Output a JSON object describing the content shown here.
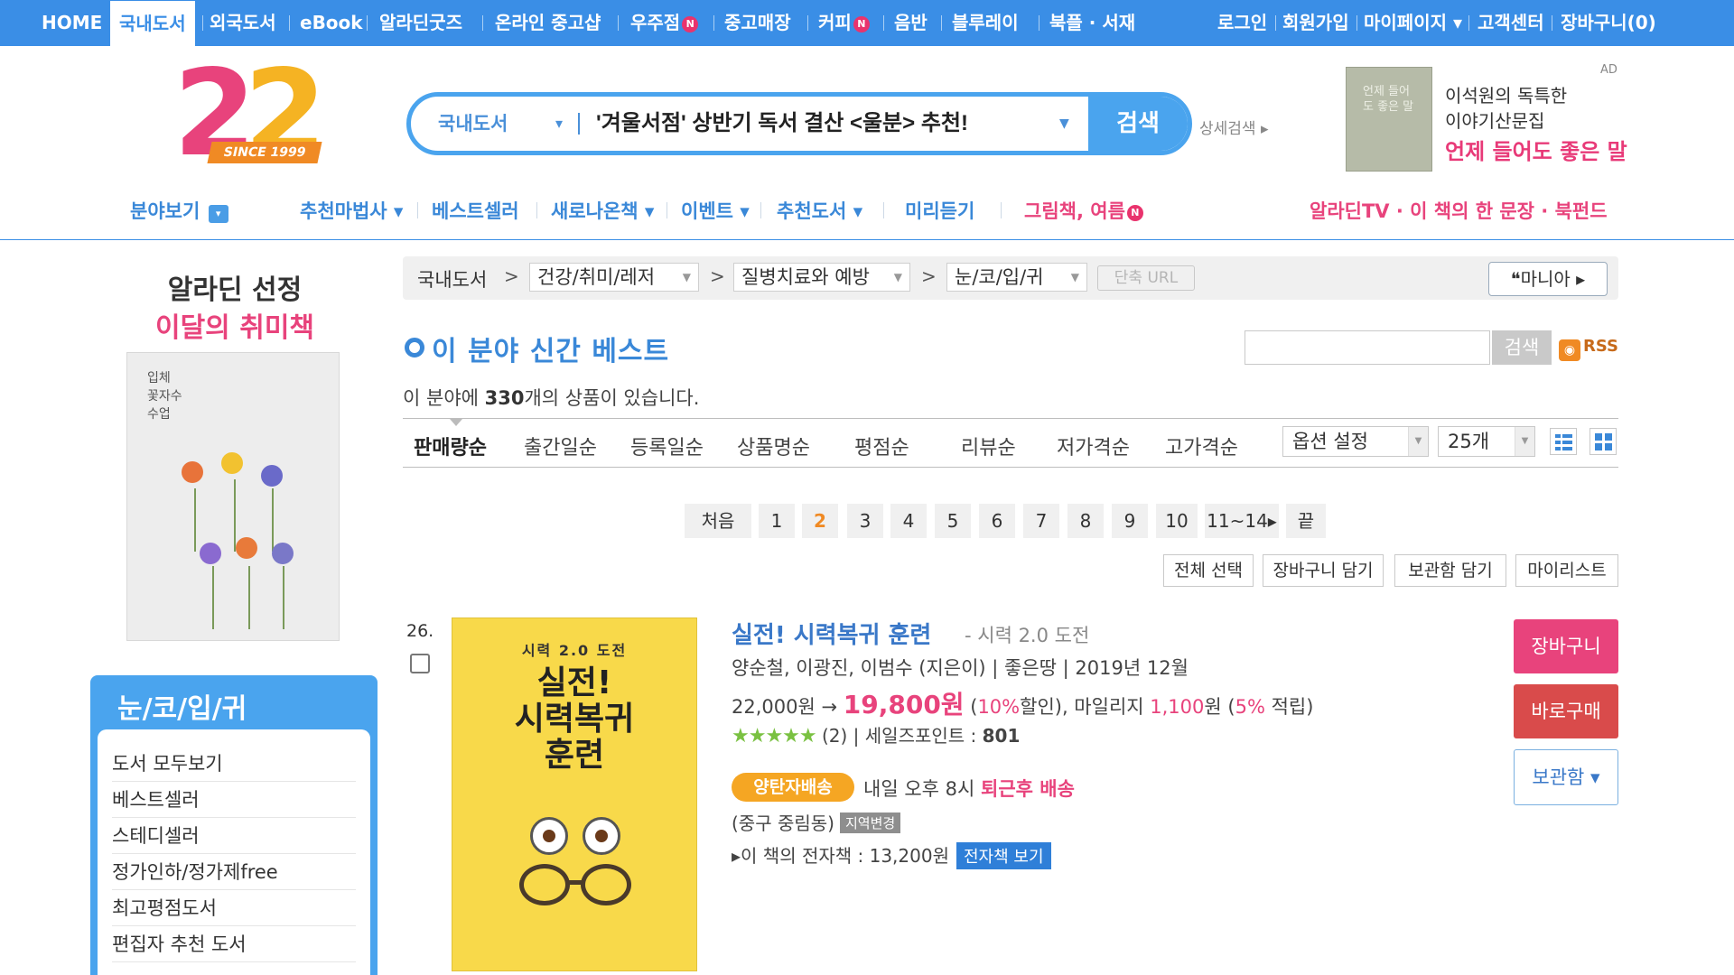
{
  "topnav": {
    "items": [
      "HOME",
      "국내도서",
      "외국도서",
      "eBook",
      "알라딘굿즈",
      "온라인 중고샵",
      "우주점",
      "중고매장",
      "커피",
      "음반",
      "블루레이",
      "북플 · 서재"
    ],
    "new_badge": "N",
    "right": [
      "로그인",
      "회원가입",
      "마이페이지 ▾",
      "고객센터",
      "장바구니(0)"
    ]
  },
  "logo": {
    "number": "22",
    "since": "SINCE 1999"
  },
  "search": {
    "category": "국내도서",
    "query": "'겨울서점' 상반기 독서 결산 <울분> 추천!",
    "button": "검색",
    "detail": "상세검색 ▸"
  },
  "ad": {
    "label": "AD",
    "book_title": "언제 들어도 좋은 말",
    "line1": "이석원의 독특한",
    "line2": "이야기산문집",
    "line3": "언제 들어도 좋은 말"
  },
  "catnav": {
    "field": "분야보기",
    "field_icon": "▾",
    "items": [
      "추천마법사 ▾",
      "베스트셀러",
      "새로나온책 ▾",
      "이벤트 ▾",
      "추천도서 ▾",
      "미리듣기"
    ],
    "pink_item": "그림책, 여름",
    "right_links": "알라딘TV · 이 책의 한 문장 · 북펀드"
  },
  "sidebar": {
    "title1": "알라딘 선정",
    "title2": "이달의 취미책",
    "book_title": "입체 꽃자수 수업",
    "box_title": "눈/코/입/귀",
    "links": [
      "도서 모두보기",
      "베스트셀러",
      "스테디셀러",
      "정가인하/정가제free",
      "최고평점도서",
      "편집자 추천 도서"
    ]
  },
  "breadcrumb": {
    "root": "국내도서",
    "sep": ">",
    "level1": "건강/취미/레저",
    "level2": "질병치료와 예방",
    "level3": "눈/코/입/귀",
    "short_url": "단축 URL",
    "mania": "❝마니아 ▸"
  },
  "section": {
    "title": "이 분야 신간 베스트",
    "search_button": "검색",
    "rss": "RSS",
    "count_prefix": "이 분야에 ",
    "count": "330",
    "count_suffix": "개의 상품이 있습니다."
  },
  "sort": {
    "options": [
      "판매량순",
      "출간일순",
      "등록일순",
      "상품명순",
      "평점순",
      "리뷰순",
      "저가격순",
      "고가격순"
    ],
    "option_select": "옵션 설정",
    "per_page": "25개"
  },
  "pagination": [
    "처음",
    "1",
    "2",
    "3",
    "4",
    "5",
    "6",
    "7",
    "8",
    "9",
    "10",
    "11~14▸",
    "끝"
  ],
  "current_page": "2",
  "actions": [
    "전체 선택",
    "장바구니 담기",
    "보관함 담기",
    "마이리스트"
  ],
  "item": {
    "rank": "26.",
    "cover_top": "시력 2.0 도전",
    "cover_title": "실전!\n시력복귀\n훈련",
    "title": "실전! 시력복귀 훈련",
    "subtitle": "- 시력 2.0 도전",
    "authors": "양순철, 이광진, 이범수 (지은이) | 좋은땅 | 2019년 12월",
    "list_price": "22,000원 → ",
    "sale_price": "19,800원",
    "discount_pre": " (",
    "discount": "10%",
    "discount_post": "할인), 마일리지 ",
    "mileage": "1,100",
    "mileage_post": "원 (",
    "mileage_rate": "5%",
    "mileage_end": " 적립)",
    "stars": "★★★★★",
    "rating_rest": " (2) | 세일즈포인트 : ",
    "sales_point": "801",
    "delivery_badge": "양탄자배송",
    "delivery_text": "내일 오후 8시 ",
    "delivery_pink": "퇴근후 배송",
    "region": "(중구 중림동)",
    "region_btn": "지역변경",
    "ebook": "▸이 책의 전자책 : 13,200원",
    "ebook_btn": "전자책 보기",
    "btn_cart": "장바구니",
    "btn_buy": "바로구매",
    "btn_keep": "보관함 ▾"
  },
  "colors": {
    "primary": "#3a8ee6",
    "pink": "#e8437c",
    "orange": "#f08a24",
    "green_star": "#7ac142"
  }
}
